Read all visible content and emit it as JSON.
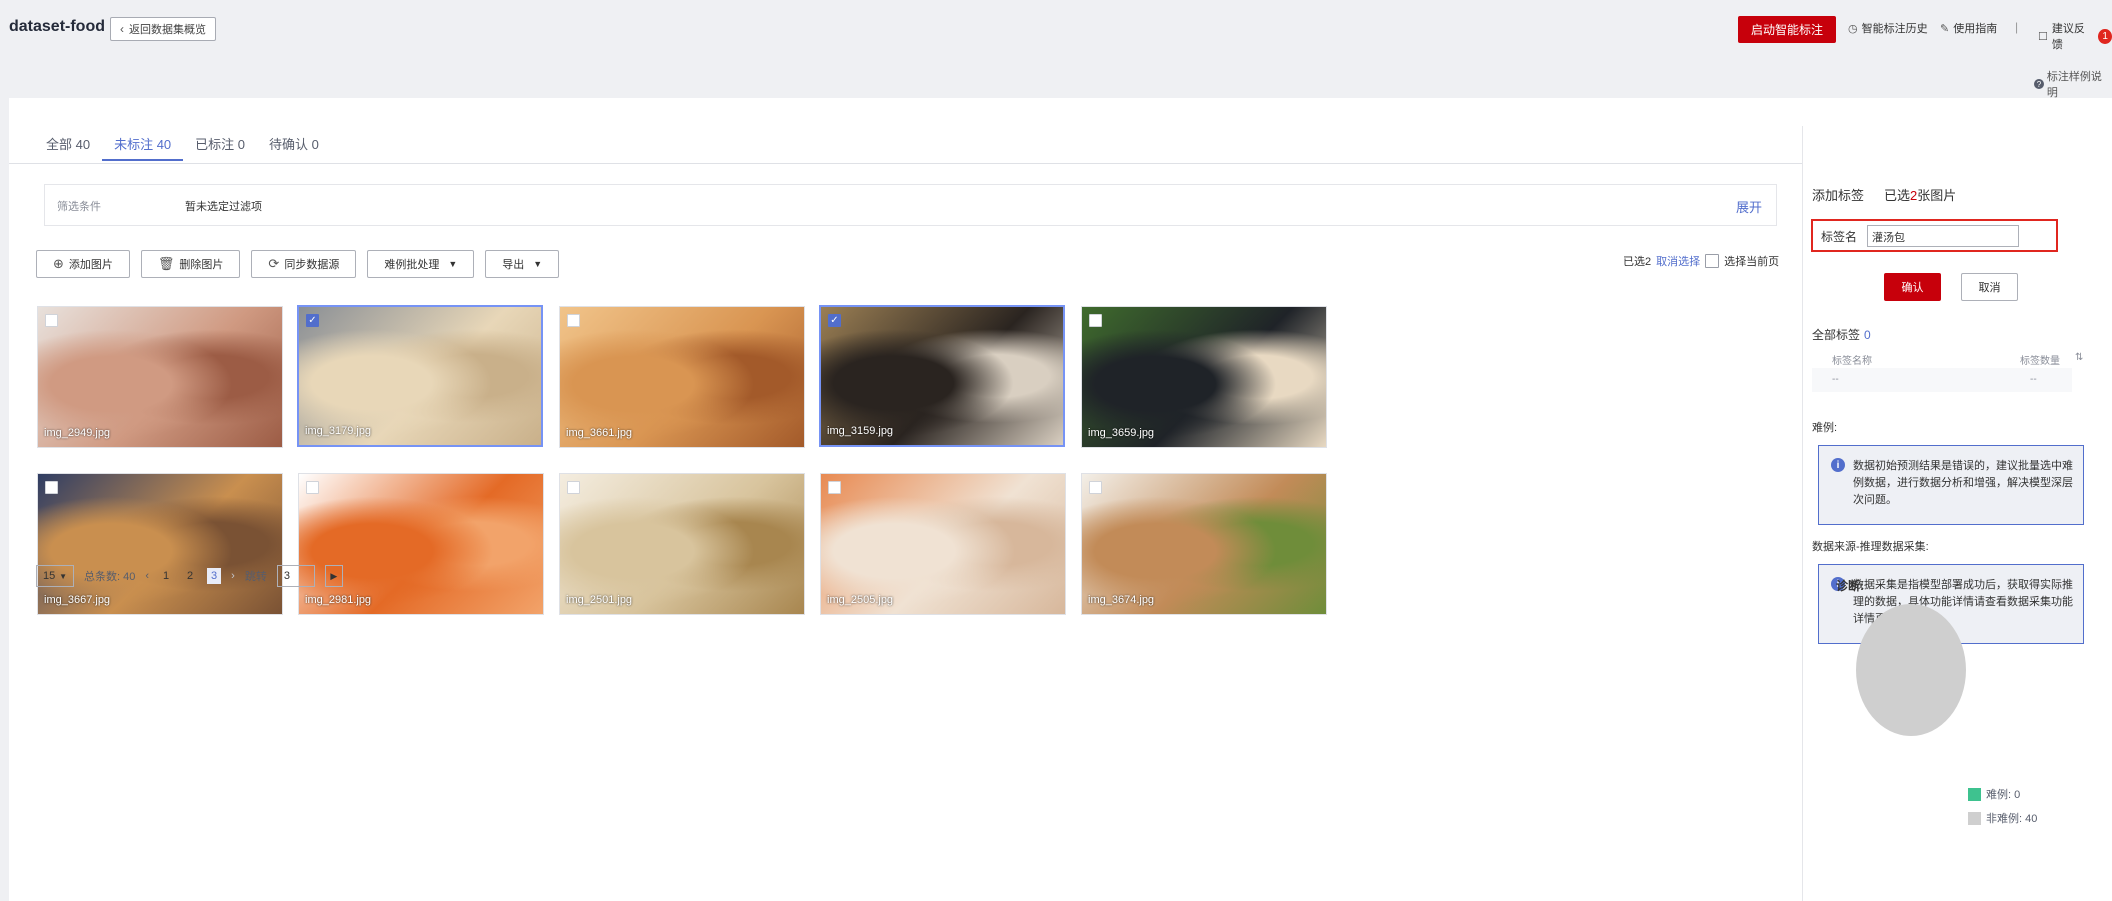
{
  "header": {
    "title": "dataset-food",
    "back_label": "返回数据集概览",
    "start_label": "启动智能标注",
    "history_label": "智能标注历史",
    "guide_label": "使用指南",
    "feedback_label": "建议反馈",
    "feedback_count": "1",
    "example_label": "标注样例说明"
  },
  "tabs": [
    {
      "label": "全部 40"
    },
    {
      "label": "未标注 40"
    },
    {
      "label": "已标注 0"
    },
    {
      "label": "待确认 0"
    }
  ],
  "filter": {
    "label": "筛选条件",
    "value": "暂未选定过滤项",
    "expand": "展开"
  },
  "toolbar": {
    "add_label": "添加图片",
    "delete_label": "删除图片",
    "sync_label": "同步数据源",
    "hard_label": "难例批处理",
    "export_label": "导出"
  },
  "selection": {
    "selected_text": "已选2",
    "cancel_text": "取消选择",
    "select_page": "选择当前页"
  },
  "images": [
    {
      "name": "img_2949.jpg",
      "selected": false,
      "colors": [
        "#d09a82",
        "#9c5c45",
        "#e8e1dc"
      ]
    },
    {
      "name": "img_3179.jpg",
      "selected": true,
      "colors": [
        "#e8d7b8",
        "#c9b08a",
        "#8a8f95"
      ]
    },
    {
      "name": "img_3661.jpg",
      "selected": false,
      "colors": [
        "#d99552",
        "#a35a2a",
        "#f1c48a"
      ]
    },
    {
      "name": "img_3159.jpg",
      "selected": true,
      "colors": [
        "#2a2420",
        "#d9cfc1",
        "#9b7f54"
      ]
    },
    {
      "name": "img_3659.jpg",
      "selected": false,
      "colors": [
        "#1f2328",
        "#e8d9c2",
        "#3f6b2d"
      ]
    },
    {
      "name": "img_3667.jpg",
      "selected": false,
      "colors": [
        "#c98f4f",
        "#7a5234",
        "#2f3d63"
      ]
    },
    {
      "name": "img_2981.jpg",
      "selected": false,
      "colors": [
        "#e46a26",
        "#f2a36a",
        "#ffffff"
      ]
    },
    {
      "name": "img_2501.jpg",
      "selected": false,
      "colors": [
        "#d8c49d",
        "#a8864f",
        "#f4ede0"
      ]
    },
    {
      "name": "img_2505.jpg",
      "selected": false,
      "colors": [
        "#f0e2d3",
        "#d7b79b",
        "#e88a52"
      ]
    },
    {
      "name": "img_3674.jpg",
      "selected": false,
      "colors": [
        "#c28b58",
        "#6f8d3a",
        "#f3efe8"
      ]
    }
  ],
  "pagination": {
    "page_size": "15",
    "total": "总条数: 40",
    "pages": [
      "1",
      "2",
      "3"
    ],
    "current": "3",
    "jump_label": "跳转",
    "jump_value": "3"
  },
  "right_panel": {
    "add_label": "添加标签",
    "selected_prefix": "已选",
    "selected_count": "2",
    "selected_suffix": "张图片",
    "name_label": "标签名",
    "name_value": "灌汤包",
    "ok_label": "确认",
    "cancel_label": "取消",
    "all_labels": "全部标签",
    "all_labels_count": "0",
    "col_name": "标签名称",
    "col_count": "标签数量",
    "empty_name": "--",
    "empty_count": "--",
    "hard_title": "难例:",
    "hard_text": "数据初始预测结果是错误的，建议批量选中难例数据，进行数据分析和增强，解决模型深层次问题。",
    "source_title": "数据来源-推理数据采集:",
    "source_text": "数据采集是指模型部署成功后，获取得实际推理的数据，具体功能详情请查看数据采集功能详情页。",
    "diag_title": "诊断:",
    "legend_hard": "难例: 0",
    "legend_nonhard": "非难例: 40",
    "hard_color": "#3ec28f",
    "nonhard_color": "#cfcfcf"
  },
  "chart_data": {
    "type": "pie",
    "title": "诊断:",
    "categories": [
      "难例",
      "非难例"
    ],
    "values": [
      0,
      40
    ]
  }
}
